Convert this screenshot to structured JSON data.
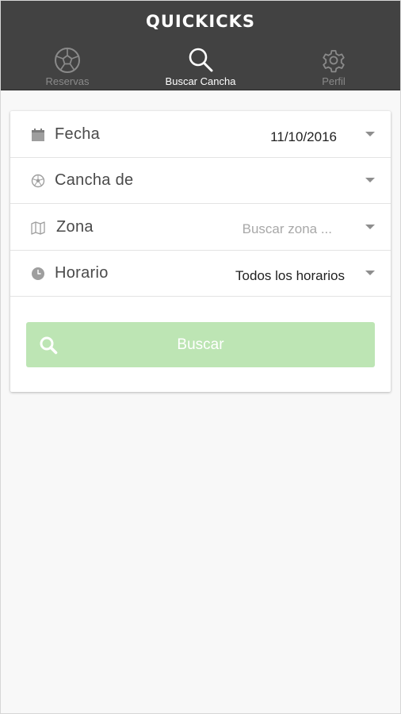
{
  "app": {
    "title": "QUICKICKS"
  },
  "nav": {
    "tabs": [
      {
        "label": "Reservas",
        "icon": "soccer-ball-icon",
        "active": false
      },
      {
        "label": "Buscar Cancha",
        "icon": "search-icon",
        "active": true
      },
      {
        "label": "Perfil",
        "icon": "gear-icon",
        "active": false
      }
    ]
  },
  "form": {
    "fecha": {
      "label": "Fecha",
      "value": "11/10/2016",
      "icon": "calendar-icon"
    },
    "cancha": {
      "label": "Cancha de",
      "value": "",
      "icon": "soccer-ball-icon"
    },
    "zona": {
      "label": "Zona",
      "placeholder": "Buscar zona ...",
      "icon": "map-icon"
    },
    "horario": {
      "label": "Horario",
      "value": "Todos los horarios",
      "icon": "clock-icon"
    }
  },
  "search_button": {
    "label": "Buscar",
    "icon": "search-icon"
  },
  "colors": {
    "header_bg": "#424242",
    "page_bg": "#f8f8f8",
    "button_bg": "#bde5b4",
    "inactive_tab": "#8a8a8a"
  }
}
